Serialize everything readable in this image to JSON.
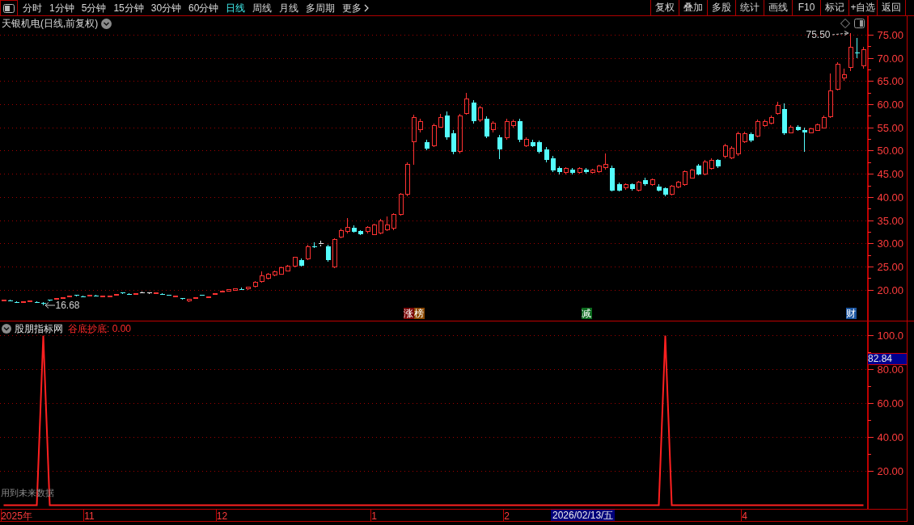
{
  "toolbar": {
    "periods": [
      {
        "label": "分时",
        "selected": false
      },
      {
        "label": "1分钟",
        "selected": false
      },
      {
        "label": "5分钟",
        "selected": false
      },
      {
        "label": "15分钟",
        "selected": false
      },
      {
        "label": "30分钟",
        "selected": false
      },
      {
        "label": "60分钟",
        "selected": false
      },
      {
        "label": "日线",
        "selected": true
      },
      {
        "label": "周线",
        "selected": false
      },
      {
        "label": "月线",
        "selected": false
      },
      {
        "label": "多周期",
        "selected": false
      }
    ],
    "more_menu": "更多",
    "actions": [
      "复权",
      "叠加",
      "多股",
      "统计",
      "画线",
      "F10",
      "标记",
      "+自选",
      "返回"
    ]
  },
  "price_pane": {
    "title": "天银机电(日线,前复权)",
    "event_tags": [
      {
        "text": "涨",
        "color": "#7a0606"
      },
      {
        "text": "榜",
        "color": "#8a4800"
      },
      {
        "text": "减",
        "color": "#0b6b1e"
      },
      {
        "text": "财",
        "color": "#1b55a0"
      }
    ],
    "chart_data": [
      {
        "type": "candlestick",
        "ohlc": [
          [
            17.7,
            17.9,
            17.6,
            17.8
          ],
          [
            17.8,
            17.9,
            17.5,
            17.6
          ],
          [
            17.45,
            17.6,
            17.3,
            17.35
          ],
          [
            17.4,
            17.6,
            17.3,
            17.5
          ],
          [
            17.45,
            17.7,
            17.35,
            17.6
          ],
          [
            17.45,
            17.55,
            17.2,
            17.25
          ],
          [
            17.25,
            17.4,
            16.68,
            17.0
          ],
          [
            17.95,
            18.0,
            17.6,
            17.7
          ],
          [
            17.95,
            18.3,
            17.85,
            18.25
          ],
          [
            18.2,
            18.5,
            18.1,
            18.45
          ],
          [
            18.55,
            18.8,
            18.45,
            18.75
          ],
          [
            18.9,
            19.0,
            18.7,
            18.75
          ],
          [
            18.65,
            18.75,
            18.45,
            18.5
          ],
          [
            18.7,
            18.9,
            18.6,
            18.85
          ],
          [
            18.85,
            18.95,
            18.6,
            18.7
          ],
          [
            18.55,
            18.75,
            18.45,
            18.7
          ],
          [
            18.55,
            18.8,
            18.5,
            18.75
          ],
          [
            18.85,
            19.1,
            18.75,
            19.05
          ],
          [
            19.45,
            19.55,
            19.2,
            19.3
          ],
          [
            19.15,
            19.25,
            18.9,
            19.0
          ],
          [
            19.0,
            19.25,
            18.9,
            19.2
          ],
          [
            19.4,
            19.6,
            19.2,
            19.4
          ],
          [
            19.4,
            19.55,
            19.25,
            19.4
          ],
          [
            19.3,
            19.5,
            19.2,
            19.45
          ],
          [
            19.15,
            19.25,
            18.95,
            19.0
          ],
          [
            18.95,
            19.05,
            18.75,
            18.8
          ],
          [
            18.55,
            18.75,
            18.45,
            18.7
          ],
          [
            18.25,
            18.35,
            17.95,
            18.05
          ],
          [
            17.7,
            18.0,
            17.4,
            17.95
          ],
          [
            18.2,
            18.5,
            18.1,
            18.45
          ],
          [
            18.95,
            19.05,
            18.75,
            18.8
          ],
          [
            18.35,
            18.6,
            18.25,
            18.55
          ],
          [
            19.05,
            19.35,
            18.95,
            19.3
          ],
          [
            19.55,
            19.85,
            19.45,
            19.8
          ],
          [
            19.75,
            20.1,
            19.65,
            20.05
          ],
          [
            19.9,
            20.3,
            19.85,
            20.25
          ],
          [
            20.25,
            20.5,
            19.95,
            20.2
          ],
          [
            20.2,
            20.8,
            20.1,
            20.7
          ],
          [
            20.8,
            21.9,
            20.6,
            21.7
          ],
          [
            21.8,
            24.0,
            21.6,
            23.0
          ],
          [
            22.5,
            23.6,
            22.3,
            23.4
          ],
          [
            23.3,
            24.2,
            23.0,
            24.0
          ],
          [
            23.5,
            25.0,
            23.3,
            24.8
          ],
          [
            24.2,
            25.4,
            24.0,
            25.2
          ],
          [
            25.1,
            27.2,
            24.9,
            27.0
          ],
          [
            26.4,
            26.8,
            25.0,
            25.3
          ],
          [
            26.7,
            29.8,
            26.5,
            29.4
          ],
          [
            29.5,
            30.3,
            29.0,
            29.4
          ],
          [
            30.0,
            30.6,
            29.5,
            30.0
          ],
          [
            29.4,
            29.8,
            26.2,
            26.4
          ],
          [
            25.0,
            31.2,
            24.8,
            31.0
          ],
          [
            31.5,
            33.2,
            31.2,
            32.8
          ],
          [
            32.6,
            35.6,
            32.3,
            33.6
          ],
          [
            33.5,
            33.9,
            32.4,
            32.6
          ],
          [
            32.8,
            33.0,
            31.8,
            32.0
          ],
          [
            32.6,
            33.8,
            32.3,
            33.5
          ],
          [
            32.0,
            34.3,
            31.8,
            34.0
          ],
          [
            32.3,
            35.3,
            32.0,
            35.0
          ],
          [
            33.0,
            35.8,
            32.8,
            34.0
          ],
          [
            33.3,
            36.6,
            33.0,
            36.3
          ],
          [
            36.3,
            40.9,
            36.0,
            40.6
          ],
          [
            40.6,
            47.5,
            40.3,
            47.1
          ],
          [
            52.0,
            57.8,
            47.0,
            57.3
          ],
          [
            54.6,
            57.0,
            54.0,
            56.4
          ],
          [
            52.0,
            52.5,
            50.2,
            50.6
          ],
          [
            51.1,
            56.0,
            50.8,
            55.5
          ],
          [
            55.2,
            58.0,
            55.0,
            57.3
          ],
          [
            57.6,
            58.5,
            52.5,
            52.9
          ],
          [
            53.8,
            54.5,
            49.3,
            49.8
          ],
          [
            49.9,
            58.0,
            49.5,
            57.6
          ],
          [
            58.1,
            62.5,
            57.8,
            61.2
          ],
          [
            60.4,
            61.0,
            56.0,
            56.4
          ],
          [
            56.7,
            59.8,
            56.3,
            59.3
          ],
          [
            56.9,
            57.5,
            52.8,
            53.2
          ],
          [
            54.6,
            56.5,
            54.0,
            56.0
          ],
          [
            52.9,
            53.5,
            48.2,
            50.3
          ],
          [
            52.9,
            57.0,
            52.5,
            56.4
          ],
          [
            55.5,
            56.8,
            55.0,
            56.4
          ],
          [
            56.4,
            56.9,
            52.0,
            52.5
          ],
          [
            51.1,
            53.0,
            50.8,
            52.5
          ],
          [
            52.0,
            52.5,
            50.8,
            51.1
          ],
          [
            52.0,
            52.3,
            49.5,
            49.8
          ],
          [
            50.3,
            50.8,
            47.6,
            48.0
          ],
          [
            48.5,
            48.9,
            45.5,
            45.9
          ],
          [
            46.3,
            46.6,
            45.0,
            45.4
          ],
          [
            45.3,
            46.5,
            45.0,
            46.2
          ],
          [
            46.0,
            46.3,
            45.0,
            45.3
          ],
          [
            45.4,
            46.5,
            45.1,
            46.2
          ],
          [
            46.0,
            46.3,
            45.2,
            45.5
          ],
          [
            45.4,
            46.2,
            45.1,
            45.9
          ],
          [
            45.6,
            47.0,
            45.3,
            46.8
          ],
          [
            46.4,
            49.4,
            46.0,
            47.2
          ],
          [
            46.4,
            46.8,
            41.2,
            41.5
          ],
          [
            42.8,
            43.2,
            41.2,
            41.5
          ],
          [
            42.0,
            43.0,
            41.6,
            42.8
          ],
          [
            42.8,
            43.0,
            41.5,
            41.8
          ],
          [
            41.5,
            43.6,
            41.2,
            43.3
          ],
          [
            43.8,
            44.2,
            42.5,
            42.8
          ],
          [
            42.8,
            44.0,
            42.5,
            43.8
          ],
          [
            42.4,
            42.8,
            41.3,
            41.5
          ],
          [
            41.9,
            42.2,
            40.3,
            40.6
          ],
          [
            40.6,
            42.6,
            40.4,
            42.4
          ],
          [
            42.2,
            43.5,
            42.0,
            43.3
          ],
          [
            42.7,
            45.8,
            42.5,
            45.5
          ],
          [
            44.2,
            46.2,
            44.0,
            45.9
          ],
          [
            46.8,
            47.2,
            44.8,
            45.0
          ],
          [
            45.0,
            48.0,
            44.7,
            47.7
          ],
          [
            46.3,
            48.5,
            46.0,
            48.0
          ],
          [
            48.0,
            48.3,
            46.3,
            46.6
          ],
          [
            48.8,
            51.5,
            48.5,
            51.1
          ],
          [
            48.5,
            51.0,
            48.2,
            50.6
          ],
          [
            49.4,
            54.2,
            49.0,
            53.8
          ],
          [
            52.0,
            54.2,
            51.8,
            53.8
          ],
          [
            53.6,
            54.0,
            52.0,
            52.3
          ],
          [
            53.2,
            56.8,
            53.0,
            56.4
          ],
          [
            55.5,
            56.8,
            55.2,
            56.4
          ],
          [
            56.0,
            57.6,
            55.8,
            57.3
          ],
          [
            58.1,
            60.7,
            57.8,
            59.9
          ],
          [
            59.0,
            60.3,
            53.5,
            53.8
          ],
          [
            54.0,
            55.5,
            53.8,
            55.2
          ],
          [
            55.3,
            55.6,
            54.3,
            54.6
          ],
          [
            54.6,
            55.0,
            49.8,
            54.0
          ],
          [
            54.0,
            55.0,
            53.8,
            54.8
          ],
          [
            54.5,
            56.0,
            54.3,
            55.6
          ],
          [
            55.0,
            57.6,
            54.8,
            57.3
          ],
          [
            57.4,
            66.8,
            57.2,
            63.0
          ],
          [
            63.4,
            69.2,
            63.1,
            68.8
          ],
          [
            65.8,
            67.7,
            65.1,
            66.4
          ],
          [
            68.1,
            75.5,
            67.2,
            72.4
          ],
          [
            71.2,
            74.4,
            70.0,
            71.1
          ],
          [
            68.4,
            72.4,
            67.7,
            71.9
          ]
        ],
        "ylim": [
          13.4,
          79.1
        ],
        "yticks": [
          {
            "value": 75,
            "label": "75.00"
          },
          {
            "value": 70,
            "label": "70.00"
          },
          {
            "value": 65,
            "label": "65.00"
          },
          {
            "value": 60,
            "label": "60.00"
          },
          {
            "value": 55,
            "label": "55.00"
          },
          {
            "value": 50,
            "label": "50.00"
          },
          {
            "value": 45,
            "label": "45.00"
          },
          {
            "value": 40,
            "label": "40.00"
          },
          {
            "value": 35,
            "label": "35.00"
          },
          {
            "value": 30,
            "label": "30.00"
          },
          {
            "value": 25,
            "label": "25.00"
          },
          {
            "value": 20,
            "label": "20.00"
          }
        ],
        "grid": true,
        "annotations": [
          "75.50",
          "16.68"
        ]
      }
    ]
  },
  "indicator_pane": {
    "name": "股朋指标网",
    "readout": "谷底抄底: 0.00",
    "note": "用到未来数据",
    "cursor_value": "82.84",
    "chart_data": [
      {
        "type": "line",
        "color": "#ff2020",
        "values": [
          0,
          0,
          0,
          0,
          0,
          0,
          100,
          0,
          0,
          0,
          0,
          0,
          0,
          0,
          0,
          0,
          0,
          0,
          0,
          0,
          0,
          0,
          0,
          0,
          0,
          0,
          0,
          0,
          0,
          0,
          0,
          0,
          0,
          0,
          0,
          0,
          0,
          0,
          0,
          0,
          0,
          0,
          0,
          0,
          0,
          0,
          0,
          0,
          0,
          0,
          0,
          0,
          0,
          0,
          0,
          0,
          0,
          0,
          0,
          0,
          0,
          0,
          0,
          0,
          0,
          0,
          0,
          0,
          0,
          0,
          0,
          0,
          0,
          0,
          0,
          0,
          0,
          0,
          0,
          0,
          0,
          0,
          0,
          0,
          0,
          0,
          0,
          0,
          0,
          0,
          0,
          0,
          0,
          0,
          0,
          0,
          0,
          0,
          0,
          0,
          100,
          0,
          0,
          0,
          0,
          0,
          0,
          0,
          0,
          0,
          0,
          0,
          0,
          0,
          0,
          0,
          0,
          0,
          0,
          0,
          0,
          0,
          0,
          0,
          0,
          0,
          0,
          0,
          0,
          0,
          0
        ],
        "categories": [
          null,
          null,
          "2025年",
          null,
          null,
          null,
          null,
          null,
          null,
          null,
          null,
          null,
          null,
          "11",
          null,
          null,
          null,
          null,
          null,
          null,
          null,
          null,
          null,
          null,
          null,
          null,
          null,
          null,
          null,
          null,
          null,
          null,
          null,
          "12",
          null,
          null,
          null,
          null,
          null,
          null,
          null,
          null,
          null,
          null,
          null,
          null,
          null,
          null,
          null,
          null,
          null,
          null,
          null,
          null,
          null,
          null,
          "1",
          null,
          null,
          null,
          null,
          null,
          null,
          null,
          null,
          null,
          null,
          null,
          null,
          null,
          null,
          null,
          null,
          null,
          null,
          null,
          "2",
          null,
          null,
          null,
          null,
          null,
          null,
          null,
          null,
          null,
          null,
          null,
          null,
          null,
          null,
          null,
          null,
          null,
          null,
          null,
          null,
          null,
          null,
          null,
          null,
          null,
          null,
          null,
          null,
          null,
          null,
          null,
          null,
          null,
          null,
          null,
          "4",
          null,
          null,
          null,
          null,
          null,
          null,
          null,
          null,
          null,
          null,
          null,
          null,
          null,
          null,
          null,
          null,
          null,
          null
        ],
        "ylim": [
          -2.15,
          108.3
        ],
        "yticks": [
          {
            "value": 100,
            "label": "100.0"
          },
          {
            "value": 80,
            "label": "80.00"
          },
          {
            "value": 60,
            "label": "60.00"
          },
          {
            "value": 40,
            "label": "40.00"
          },
          {
            "value": 20,
            "label": "20.00"
          }
        ],
        "grid": true
      }
    ]
  },
  "time_axis": {
    "cursor_date": "2026/02/13/五"
  }
}
